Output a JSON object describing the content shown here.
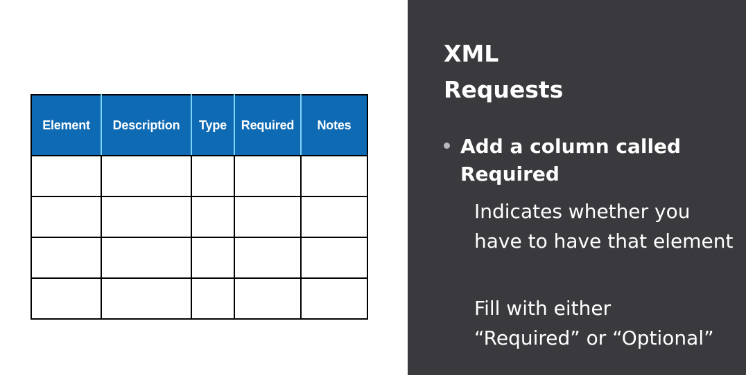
{
  "table": {
    "headers": [
      "Element",
      "Description",
      "Type",
      "Required",
      "Notes"
    ],
    "empty_rows": 4
  },
  "slide": {
    "title_line1": "XML",
    "title_line2": "Requests",
    "bullet": "Add a column called Required",
    "sub1": "Indicates whether you have to have that element",
    "sub2_line1": "Fill with either",
    "sub2_line2": "“Required” or “Optional”"
  },
  "colors": {
    "header_fill": "#0f6ab4",
    "header_divider": "#7fd3f5",
    "panel_bg": "#3a3a3e"
  }
}
